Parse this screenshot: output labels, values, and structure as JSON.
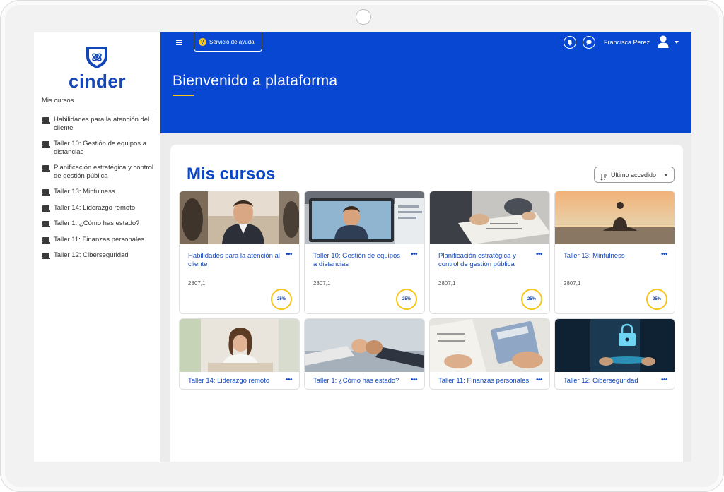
{
  "app": {
    "logo_text": "cinder",
    "accent_color": "#0747d1",
    "highlight_color": "#f5c518"
  },
  "sidebar": {
    "title": "Mis cursos",
    "items": [
      {
        "label": "Habilidades para la atención del cliente"
      },
      {
        "label": "Taller 10: Gestión de equipos a distancias"
      },
      {
        "label": "Planificación estratégica y control de gestión pública"
      },
      {
        "label": "Taller 13: Minfulness"
      },
      {
        "label": "Taller 14: Liderazgo remoto"
      },
      {
        "label": "Taller 1: ¿Cómo has estado?"
      },
      {
        "label": "Taller 11: Finanzas personales"
      },
      {
        "label": "Taller 12: Ciberseguridad"
      }
    ]
  },
  "header": {
    "help_label": "Servicio de ayuda",
    "user_name": "Francisca Perez",
    "welcome": "Bienvenido a plataforma"
  },
  "main": {
    "title": "Mis cursos",
    "sort_label": "Último accedido",
    "courses": [
      {
        "title": "Habilidades para la atención al cliente",
        "code": "2807,1",
        "progress": "25%",
        "image": "business-man-smiling"
      },
      {
        "title": "Taller 10: Gestión de equipos a distancias",
        "code": "2807,1",
        "progress": "25%",
        "image": "video-call"
      },
      {
        "title": "Planificación estratégica y control de gestión pública",
        "code": "2807,1",
        "progress": "25%",
        "image": "documents-meeting"
      },
      {
        "title": "Taller 13: Minfulness",
        "code": "2807,1",
        "progress": "25%",
        "image": "meditation-sunset"
      },
      {
        "title": "Taller 14: Liderazgo remoto",
        "image": "woman-smiling"
      },
      {
        "title": "Taller 1: ¿Cómo has estado?",
        "image": "fist-bump"
      },
      {
        "title": "Taller 11: Finanzas personales",
        "image": "calculator"
      },
      {
        "title": "Taller 12: Ciberseguridad",
        "image": "digital-lock"
      }
    ]
  }
}
